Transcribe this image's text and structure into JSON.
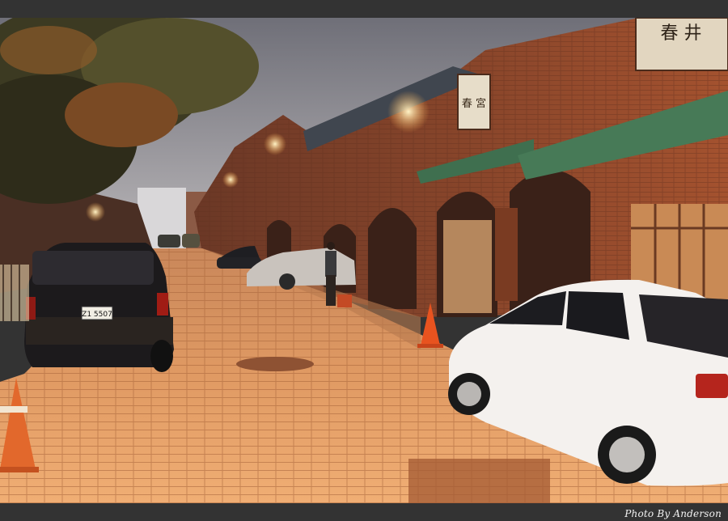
{
  "photo": {
    "credit": "Photo By Anderson",
    "sign_left": "春 宮",
    "sign_top": "春 井",
    "plate": "Z1 5507"
  },
  "colors": {
    "frame": "#333333",
    "brick": "#9a4a2e",
    "awning": "#3f6f4f",
    "cobble": "#e0935a",
    "sky": "#8f8f98"
  }
}
